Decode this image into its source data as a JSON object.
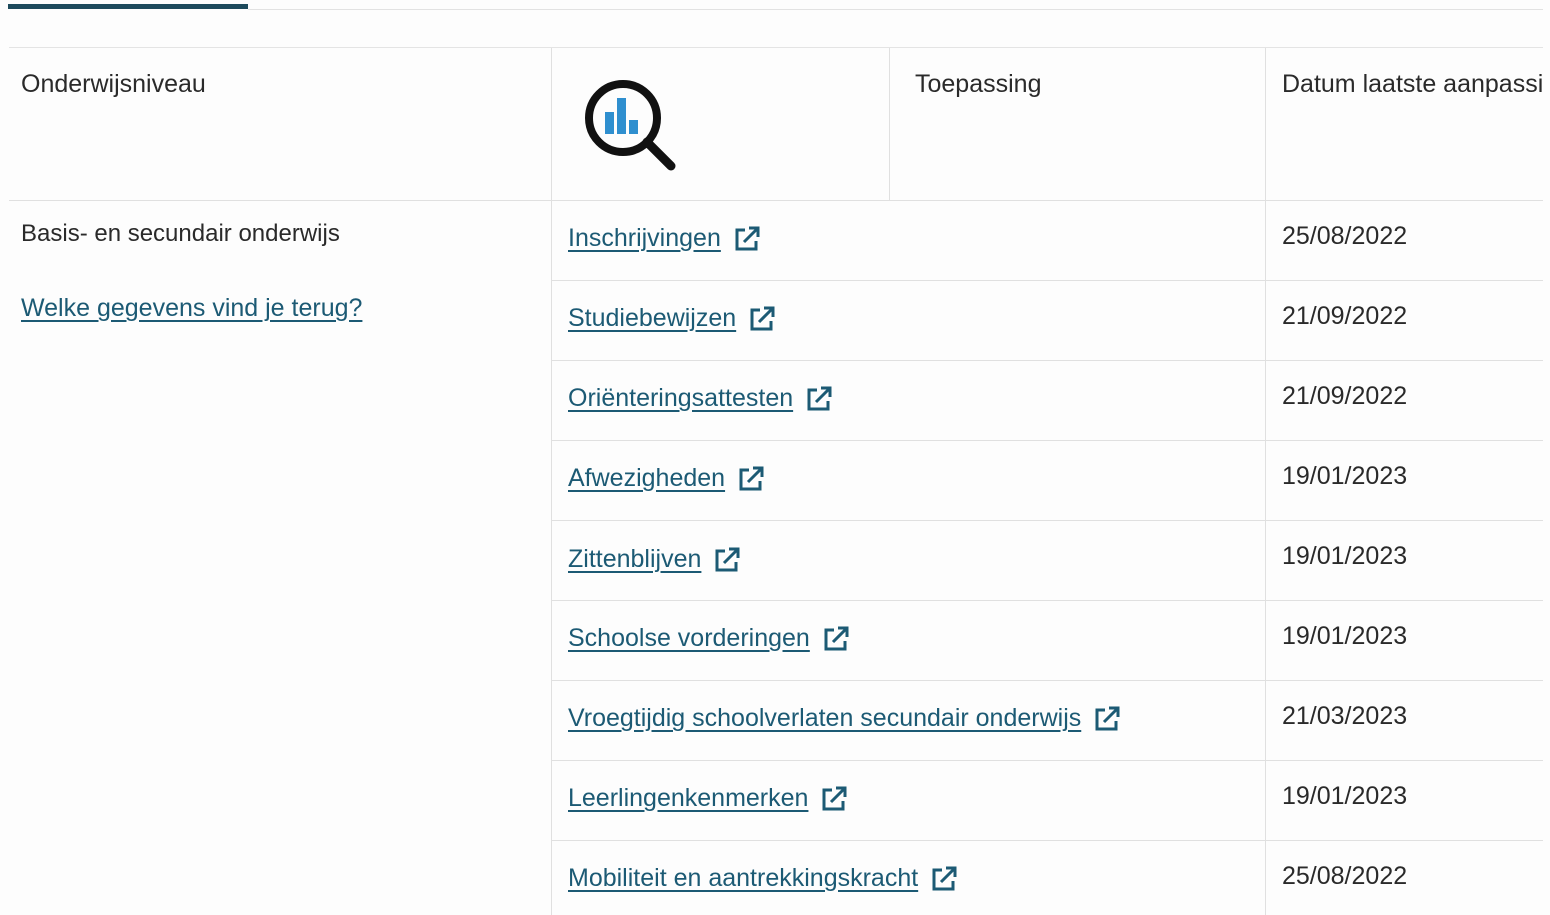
{
  "headers": {
    "level": "Onderwijsniveau",
    "application": "Toepassing",
    "date": "Datum laatste aanpassi"
  },
  "icons": {
    "header_icon": "chart-magnifier-icon",
    "external_link": "external-link-icon"
  },
  "colors": {
    "link": "#1c5a74",
    "tab_indicator": "#1d4a5c",
    "chart_bars": "#2f8fcf"
  },
  "section": {
    "level": "Basis- en secundair onderwijs",
    "info_link": "Welke gegevens vind je terug?"
  },
  "rows": [
    {
      "label": "Inschrijvingen",
      "date": "25/08/2022"
    },
    {
      "label": "Studiebewijzen",
      "date": "21/09/2022"
    },
    {
      "label": "Oriënteringsattesten",
      "date": "21/09/2022"
    },
    {
      "label": "Afwezigheden",
      "date": "19/01/2023"
    },
    {
      "label": "Zittenblijven",
      "date": "19/01/2023"
    },
    {
      "label": "Schoolse vorderingen",
      "date": "19/01/2023"
    },
    {
      "label": "Vroegtijdig schoolverlaten secundair onderwijs",
      "date": "21/03/2023"
    },
    {
      "label": "Leerlingenkenmerken",
      "date": "19/01/2023"
    },
    {
      "label": "Mobiliteit en aantrekkingskracht",
      "date": "25/08/2022"
    }
  ]
}
